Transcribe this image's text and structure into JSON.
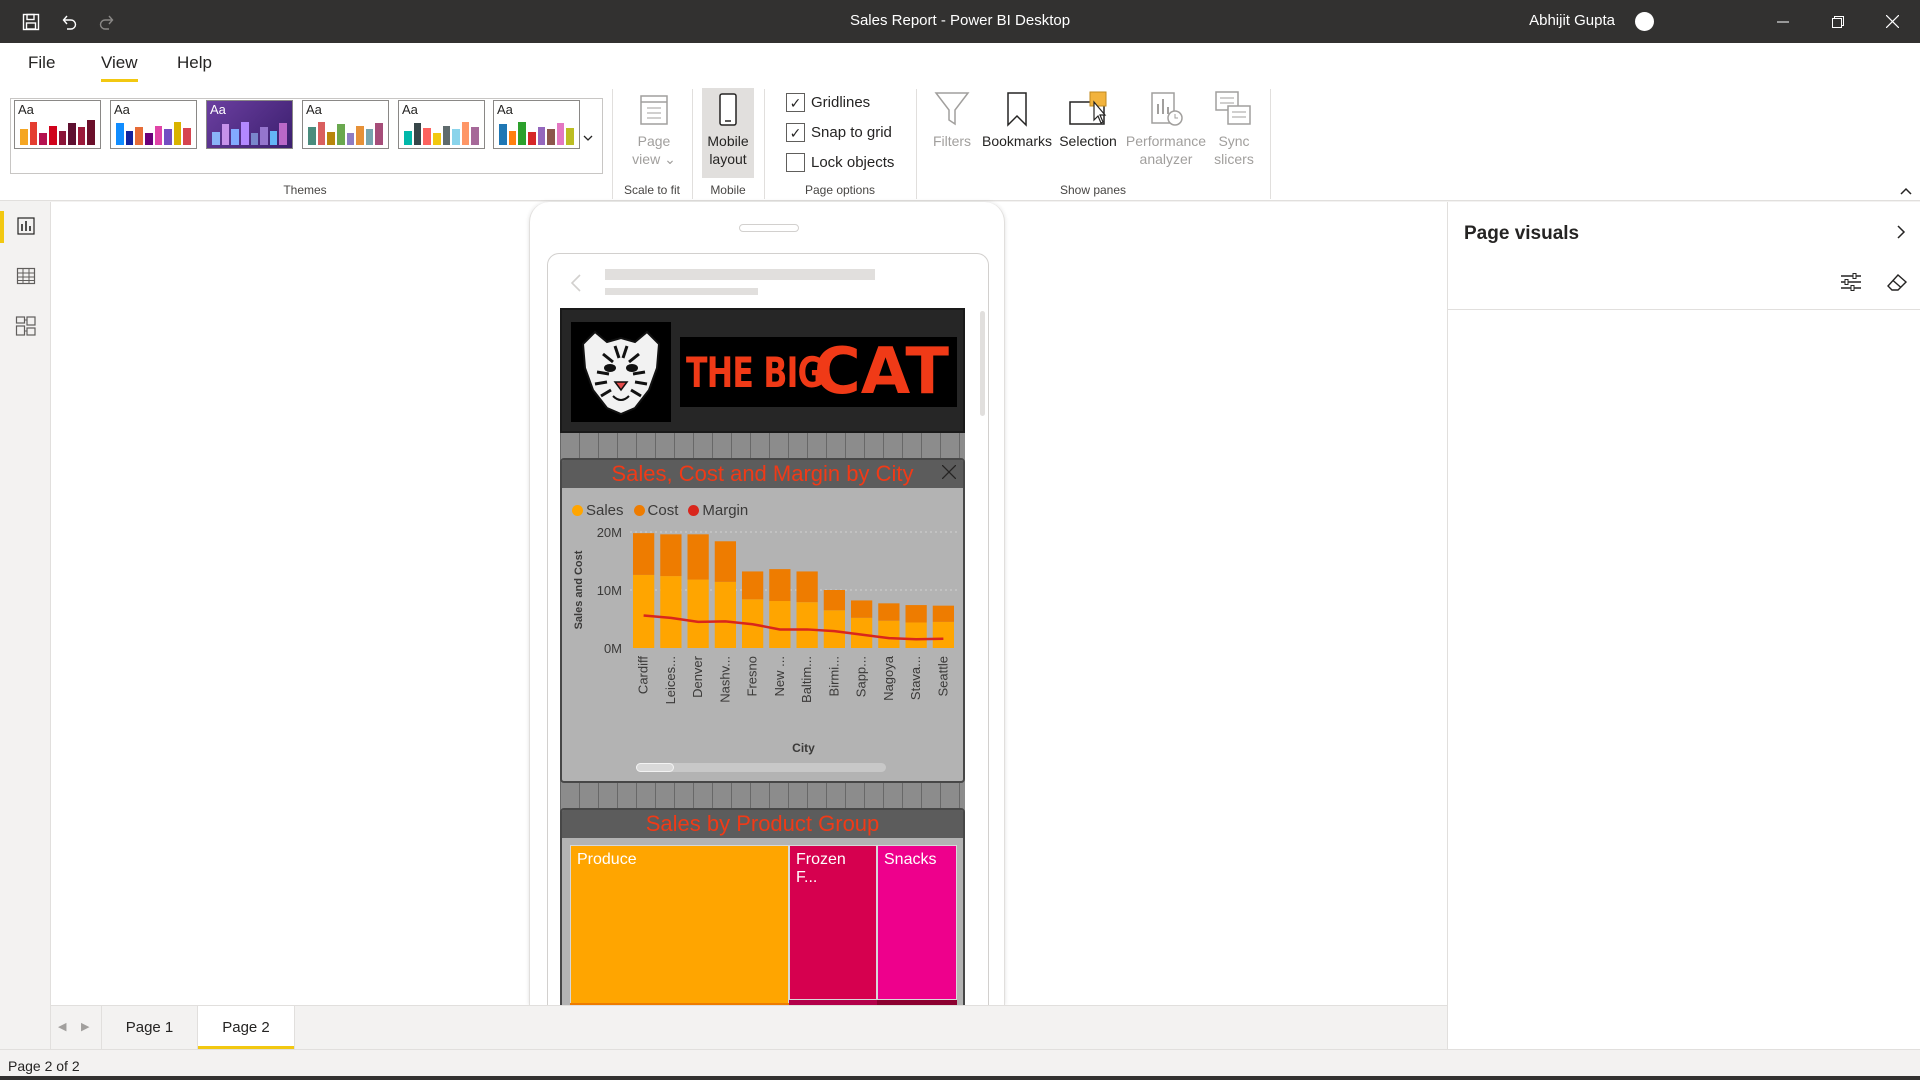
{
  "window": {
    "title": "Sales Report - Power BI Desktop",
    "user": "Abhijit Gupta"
  },
  "menu": {
    "items": [
      "File",
      "View",
      "Help"
    ],
    "active": "View"
  },
  "ribbon": {
    "groups": {
      "themes": "Themes",
      "scale": "Scale to fit",
      "mobile": "Mobile",
      "page_options": "Page options",
      "show_panes": "Show panes"
    },
    "theme_label": "Aa",
    "page_view": [
      "Page",
      "view"
    ],
    "mobile_layout": [
      "Mobile",
      "layout"
    ],
    "checkboxes": [
      {
        "label": "Gridlines",
        "checked": true
      },
      {
        "label": "Snap to grid",
        "checked": true
      },
      {
        "label": "Lock objects",
        "checked": false
      }
    ],
    "panes": {
      "filters": "Filters",
      "bookmarks": "Bookmarks",
      "selection": "Selection",
      "performance": [
        "Performance",
        "analyzer"
      ],
      "sync": [
        "Sync",
        "slicers"
      ]
    }
  },
  "right_pane": {
    "title": "Page visuals"
  },
  "canvas": {
    "logo": {
      "text_small": "THE BIG",
      "text_large": "CAT"
    }
  },
  "chart_data": [
    {
      "type": "bar",
      "title": "Sales, Cost and Margin by City",
      "xlabel": "City",
      "ylabel": "Sales and Cost",
      "ylim": [
        0,
        20000000
      ],
      "y_ticks": [
        "20M",
        "10M",
        "0M"
      ],
      "categories": [
        "Cardiff",
        "Leices...",
        "Denver",
        "Nashv...",
        "Fresno",
        "New ...",
        "Baltim...",
        "Birmi...",
        "Sapp...",
        "Nagoya",
        "Stava...",
        "Seattle"
      ],
      "stacked": true,
      "series": [
        {
          "name": "Sales",
          "color": "#ffa500",
          "values": [
            12.6,
            12.4,
            11.8,
            11.4,
            8.4,
            8.1,
            7.9,
            6.5,
            5.2,
            4.7,
            4.4,
            4.5
          ]
        },
        {
          "name": "Cost",
          "color": "#ee7c00",
          "values": [
            7.2,
            7.2,
            7.8,
            7.0,
            4.8,
            5.5,
            5.3,
            3.5,
            3.0,
            3.0,
            3.0,
            2.8
          ]
        },
        {
          "name": "Margin",
          "color": "#d9261c",
          "type": "line",
          "values": [
            5.6,
            5.2,
            4.5,
            4.6,
            4.1,
            3.2,
            3.2,
            2.9,
            2.3,
            1.7,
            1.5,
            1.6
          ]
        }
      ],
      "scroll_note": ""
    },
    {
      "type": "treemap",
      "title": "Sales by Product Group",
      "items": [
        {
          "label": "Produce",
          "color": "#ffa500"
        },
        {
          "label": "Frozen F...",
          "color": "#d6004f"
        },
        {
          "label": "Snacks",
          "color": "#ee008c"
        }
      ]
    }
  ],
  "pages": {
    "tabs": [
      "Page 1",
      "Page 2"
    ],
    "active": "Page 2",
    "status": "Page 2 of 2"
  }
}
